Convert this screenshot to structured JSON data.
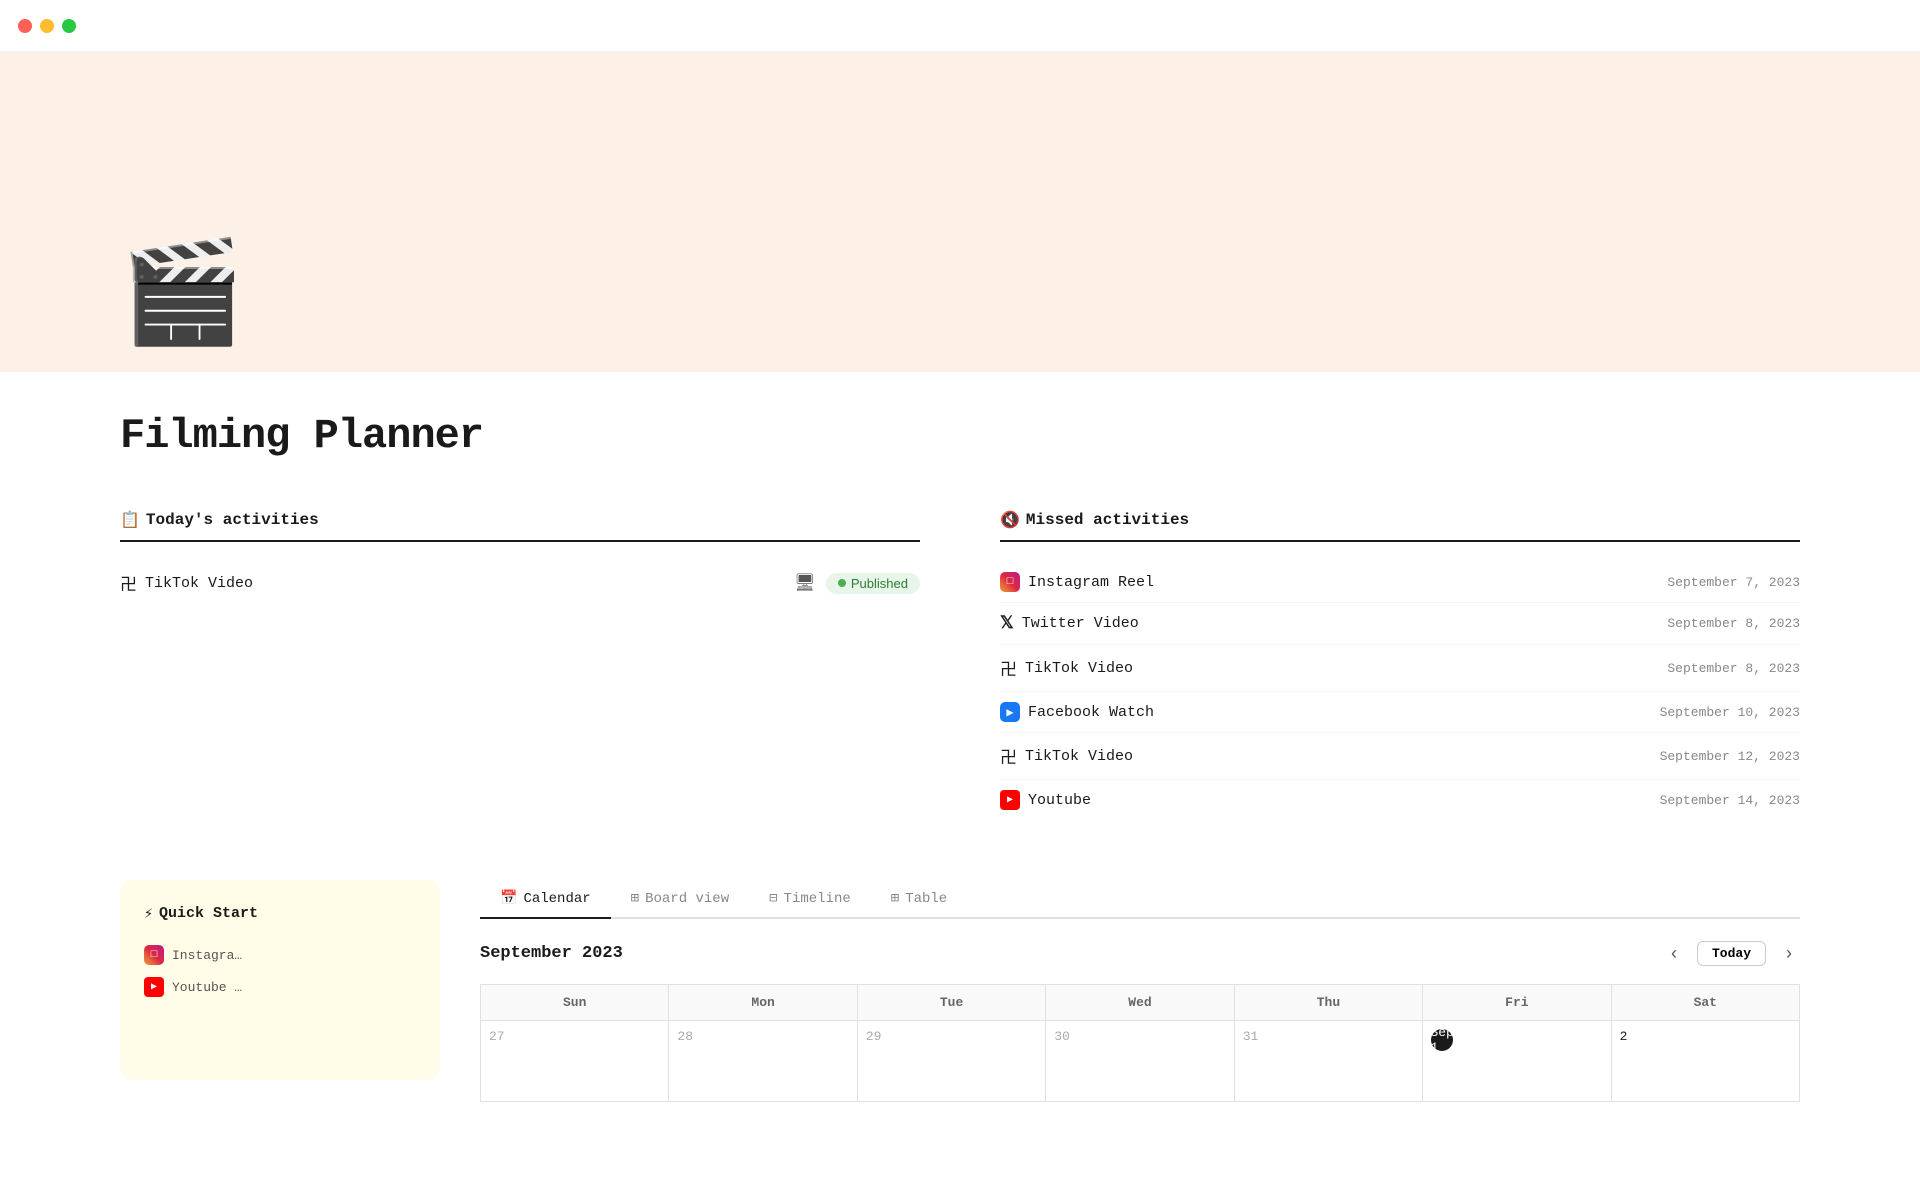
{
  "titlebar": {
    "traffic": [
      "red",
      "yellow",
      "green"
    ]
  },
  "hero": {
    "icon": "🎬"
  },
  "page": {
    "title": "Filming Planner"
  },
  "today_activities": {
    "section_icon": "📋",
    "section_label": "Today's activities",
    "items": [
      {
        "icon": "tiktok",
        "label": "TikTok Video",
        "status": "Published",
        "has_monitor": true
      }
    ]
  },
  "missed_activities": {
    "section_icon": "🔇",
    "section_label": "Missed activities",
    "items": [
      {
        "icon": "instagram",
        "label": "Instagram Reel",
        "date": "September 7, 2023"
      },
      {
        "icon": "twitter",
        "label": "Twitter Video",
        "date": "September 8, 2023"
      },
      {
        "icon": "tiktok",
        "label": "TikTok Video",
        "date": "September 8, 2023"
      },
      {
        "icon": "facebook",
        "label": "Facebook Watch",
        "date": "September 10, 2023"
      },
      {
        "icon": "tiktok",
        "label": "TikTok Video",
        "date": "September 12, 2023"
      },
      {
        "icon": "youtube",
        "label": "Youtube",
        "date": "September 14, 2023"
      }
    ]
  },
  "quick_start": {
    "icon": "⚡",
    "title": "Quick Start",
    "items": [
      {
        "icon": "instagram",
        "label": "Instagra…"
      },
      {
        "icon": "youtube",
        "label": "Youtube …"
      }
    ]
  },
  "view_tabs": [
    {
      "id": "calendar",
      "icon": "📅",
      "label": "Calendar",
      "active": true
    },
    {
      "id": "board",
      "icon": "⊞",
      "label": "Board view",
      "active": false
    },
    {
      "id": "timeline",
      "icon": "⊟",
      "label": "Timeline",
      "active": false
    },
    {
      "id": "table",
      "icon": "⊞",
      "label": "Table",
      "active": false
    }
  ],
  "calendar": {
    "month_label": "September 2023",
    "today_label": "Today",
    "days_of_week": [
      "Sun",
      "Mon",
      "Tue",
      "Wed",
      "Thu",
      "Fri",
      "Sat"
    ],
    "weeks": [
      [
        {
          "num": "27",
          "current": false
        },
        {
          "num": "28",
          "current": false
        },
        {
          "num": "29",
          "current": false
        },
        {
          "num": "30",
          "current": false
        },
        {
          "num": "31",
          "current": false
        },
        {
          "num": "Sep 1",
          "current": true,
          "today": true
        },
        {
          "num": "2",
          "current": true
        }
      ]
    ]
  },
  "colors": {
    "hero_bg": "#fdf0e6",
    "published_bg": "#e8f5e9",
    "published_text": "#2e7d32",
    "published_dot": "#4caf50",
    "accent": "#1a1a1a",
    "quick_start_bg": "#fffde7"
  }
}
